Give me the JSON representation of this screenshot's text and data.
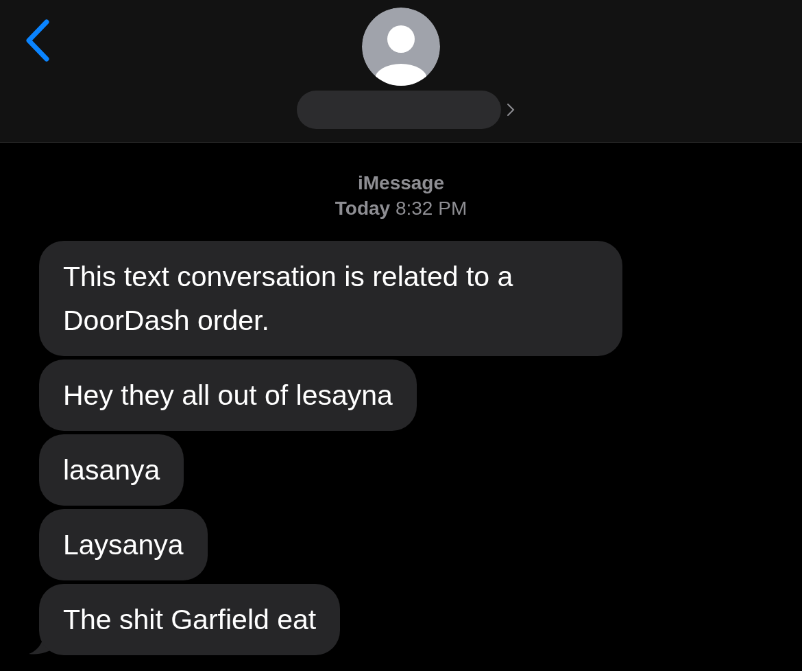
{
  "header": {
    "service": "iMessage",
    "timestamp": "**Today** 8:32 PM"
  },
  "messages": [
    {
      "text": "This text conversation is related to a DoorDash order.",
      "tail": false
    },
    {
      "text": "Hey they all out of lesayna",
      "tail": false
    },
    {
      "text": "lasanya",
      "tail": false
    },
    {
      "text": "Laysanya",
      "tail": false
    },
    {
      "text": "The shit Garfield eat",
      "tail": true
    }
  ]
}
